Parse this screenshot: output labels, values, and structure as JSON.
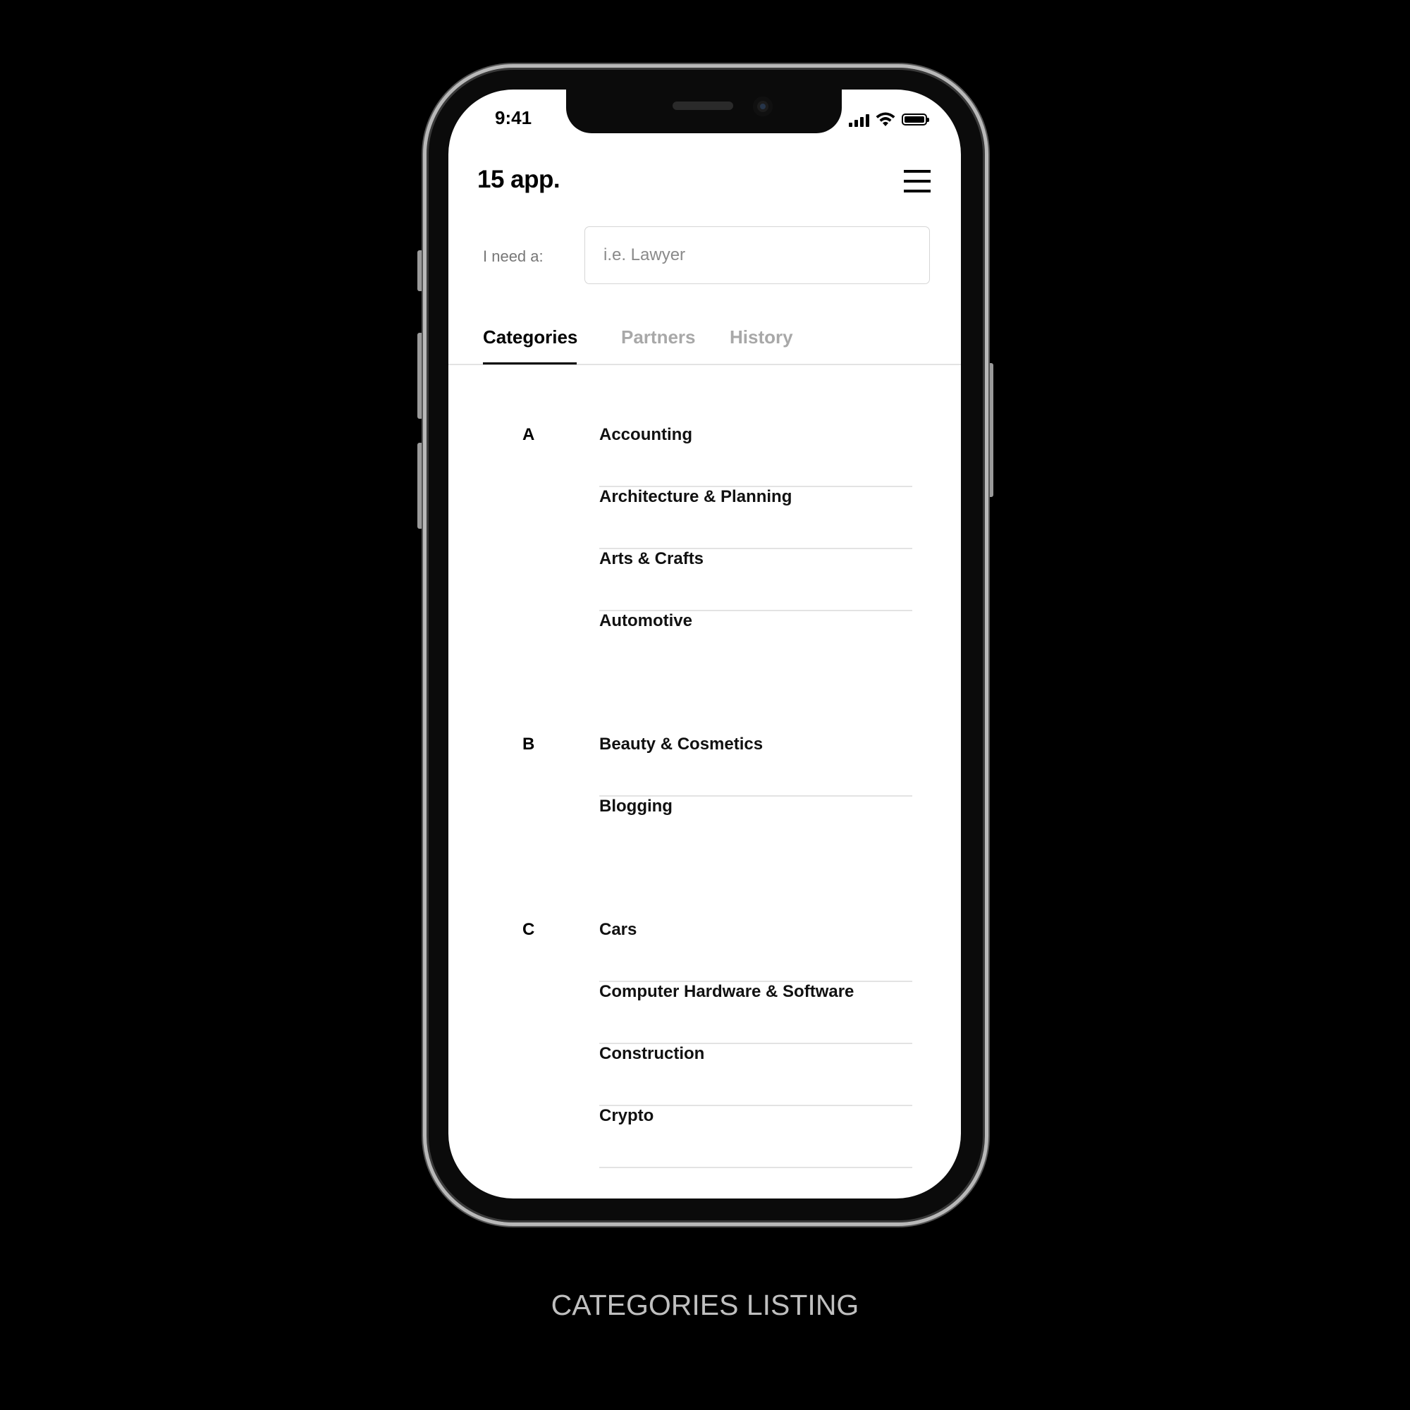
{
  "status_bar": {
    "time": "9:41"
  },
  "header": {
    "brand": "15 app."
  },
  "search": {
    "label": "I need a:",
    "placeholder": "i.e. Lawyer",
    "value": ""
  },
  "tabs": [
    {
      "label": "Categories",
      "active": true
    },
    {
      "label": "Partners",
      "active": false
    },
    {
      "label": "History",
      "active": false
    }
  ],
  "groups": [
    {
      "letter": "A",
      "items": [
        "Accounting",
        "Architecture & Planning",
        "Arts & Crafts",
        "Automotive"
      ]
    },
    {
      "letter": "B",
      "items": [
        "Beauty & Cosmetics",
        "Blogging"
      ]
    },
    {
      "letter": "C",
      "items": [
        "Cars",
        "Computer Hardware & Software",
        "Construction",
        "Crypto"
      ]
    }
  ],
  "caption": "CATEGORIES LISTING",
  "colors": {
    "background": "#000000",
    "screen": "#ffffff",
    "inactive_tab": "#a8a8a8",
    "divider": "#e3e3e3"
  }
}
